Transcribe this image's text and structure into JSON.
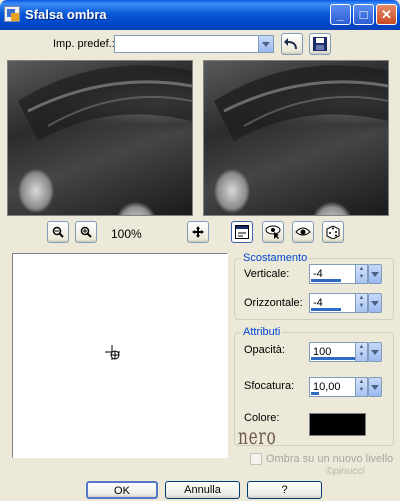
{
  "window": {
    "title": "Sfalsa ombra",
    "min_glyph": "_",
    "max_glyph": "□",
    "close_glyph": "✕"
  },
  "preset": {
    "label": "Imp. predef.:",
    "value": ""
  },
  "zoom": {
    "level": "100%"
  },
  "offset_group": {
    "title": "Scostamento",
    "vertical_label": "Verticale:",
    "vertical_value": "-4",
    "horizontal_label": "Orizzontale:",
    "horizontal_value": "-4"
  },
  "attributes_group": {
    "title": "Attributi",
    "opacity_label": "Opacità:",
    "opacity_value": "100",
    "blur_label": "Sfocatura:",
    "blur_value": "10,00",
    "color_label": "Colore:",
    "color_hex": "#000000",
    "color_caption": "nero"
  },
  "new_layer_checkbox": {
    "label": "Ombra su un nuovo livello",
    "checked": false
  },
  "buttons": {
    "ok": "OK",
    "cancel": "Annulla",
    "help": "?"
  },
  "watermark": "©pinucci"
}
